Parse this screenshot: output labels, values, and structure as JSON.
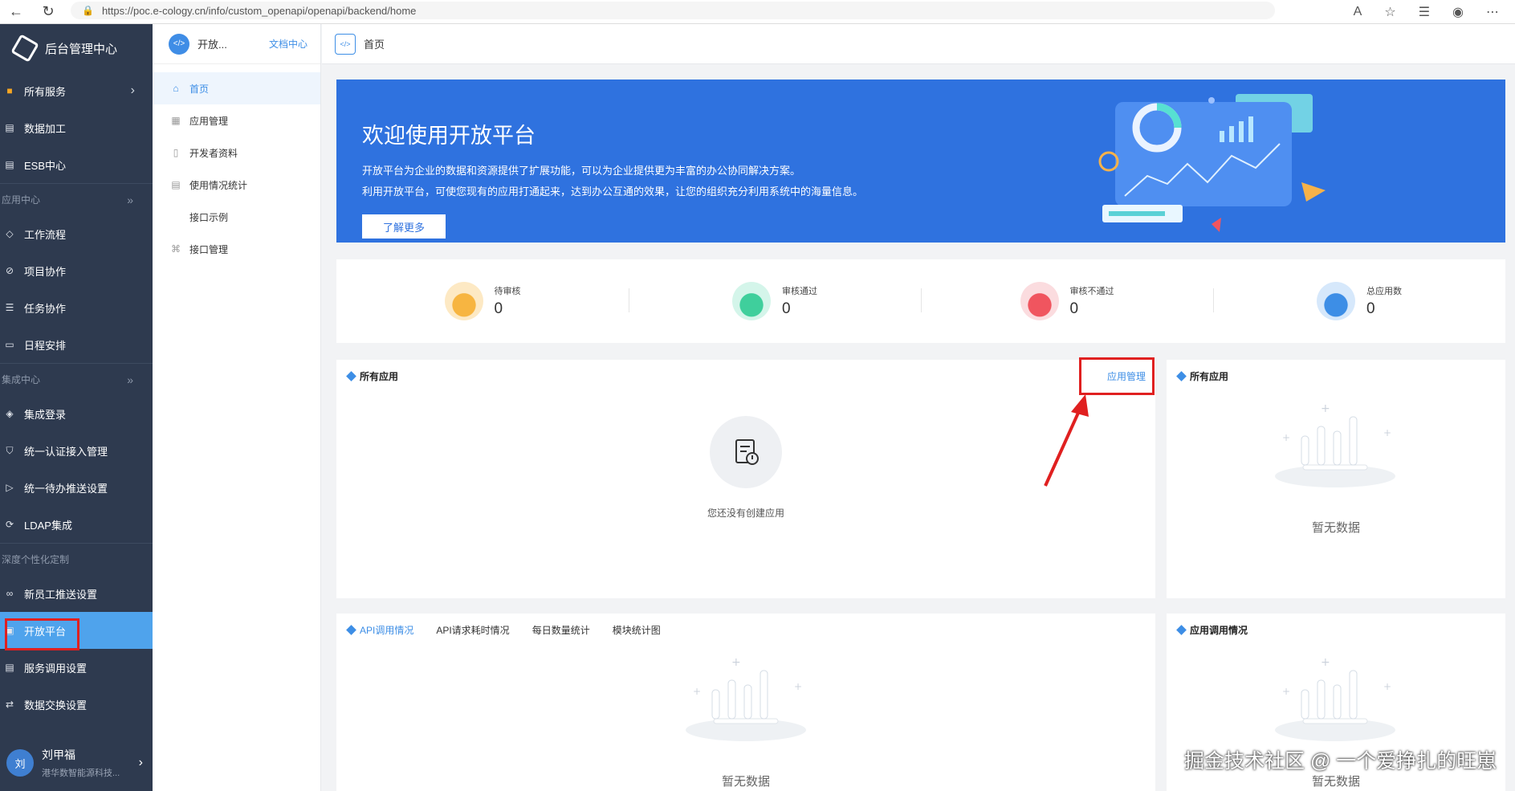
{
  "browser": {
    "url": "https://poc.e-cology.cn/info/custom_openapi/openapi/backend/home"
  },
  "sidebar": {
    "brand": "后台管理中心",
    "all_services": "所有服务",
    "items_top": [
      {
        "label": "数据加工",
        "icon": "table-icon"
      },
      {
        "label": "ESB中心",
        "icon": "table-icon"
      }
    ],
    "group_app": "应用中心",
    "items_app": [
      {
        "label": "工作流程"
      },
      {
        "label": "项目协作"
      },
      {
        "label": "任务协作"
      },
      {
        "label": "日程安排"
      }
    ],
    "group_integration": "集成中心",
    "items_integration": [
      {
        "label": "集成登录"
      },
      {
        "label": "统一认证接入管理"
      },
      {
        "label": "统一待办推送设置"
      },
      {
        "label": "LDAP集成"
      }
    ],
    "group_custom": "深度个性化定制",
    "items_custom": [
      {
        "label": "新员工推送设置"
      },
      {
        "label": "开放平台"
      },
      {
        "label": "服务调用设置"
      },
      {
        "label": "数据交换设置"
      }
    ],
    "user": {
      "avatar": "刘",
      "name": "刘甲福",
      "org": "港华数智能源科技..."
    }
  },
  "subnav": {
    "title": "开放...",
    "doc_link": "文档中心",
    "items": [
      {
        "label": "首页"
      },
      {
        "label": "应用管理"
      },
      {
        "label": "开发者资料"
      },
      {
        "label": "使用情况统计"
      },
      {
        "label": "接口示例"
      },
      {
        "label": "接口管理"
      }
    ]
  },
  "breadcrumb": {
    "label": "首页"
  },
  "banner": {
    "title": "欢迎使用开放平台",
    "desc1": "开放平台为企业的数据和资源提供了扩展功能，可以为企业提供更为丰富的办公协同解决方案。",
    "desc2": "利用开放平台，可使您现有的应用打通起来，达到办公互通的效果，让您的组织充分利用系统中的海量信息。",
    "button": "了解更多"
  },
  "stats": [
    {
      "label": "待审核",
      "value": "0",
      "color": "#f7b541"
    },
    {
      "label": "审核通过",
      "value": "0",
      "color": "#3fcf9c"
    },
    {
      "label": "审核不通过",
      "value": "0",
      "color": "#f0555f"
    },
    {
      "label": "总应用数",
      "value": "0",
      "color": "#3d8ee6"
    }
  ],
  "all_apps_panel": {
    "title": "所有应用",
    "manage_link": "应用管理",
    "empty_text": "您还没有创建应用"
  },
  "all_apps_side": {
    "title": "所有应用",
    "nodata": "暂无数据"
  },
  "api_panel": {
    "tabs": [
      "API调用情况",
      "API请求耗时情况",
      "每日数量统计",
      "模块统计图"
    ],
    "nodata": "暂无数据"
  },
  "app_call_panel": {
    "title": "应用调用情况",
    "nodata": "暂无数据"
  },
  "watermark": "掘金技术社区 @ 一个爱挣扎的旺崽"
}
